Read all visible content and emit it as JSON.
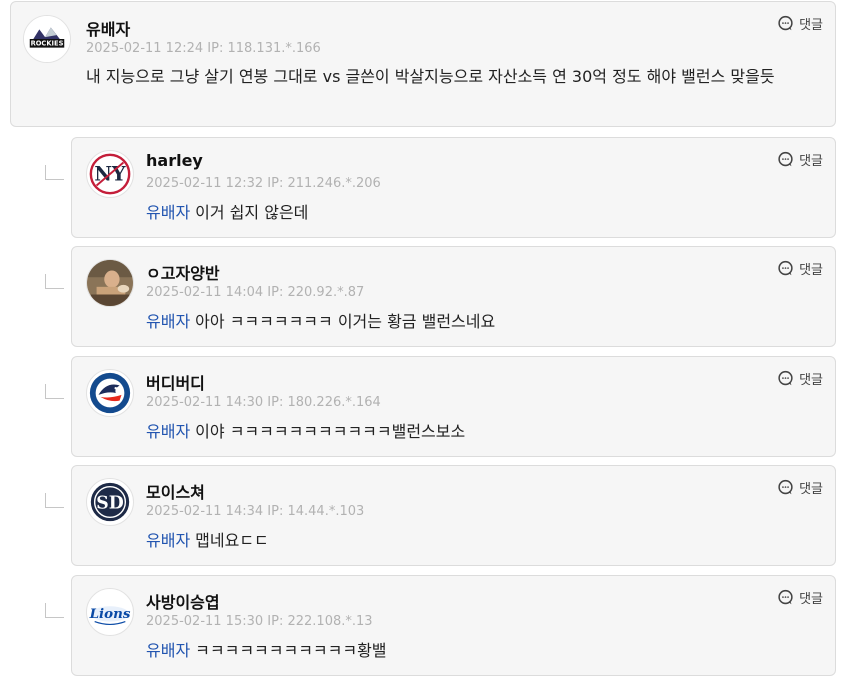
{
  "reply_label": "댓글",
  "mention_name": "유배자",
  "main_comment": {
    "author": "유배자",
    "timestamp": "2025-02-11 12:24",
    "ip": "IP: 118.131.*.166",
    "text": "내 지능으로 그냥 살기 연봉 그대로 vs 글쓴이 박살지능으로 자산소득 연 30억 정도 해야 밸런스 맞을듯",
    "avatar": "rockies-logo"
  },
  "replies": [
    {
      "author": "harley",
      "timestamp": "2025-02-11 12:32",
      "ip": "IP: 211.246.*.206",
      "text": "이거 쉽지 않은데",
      "avatar": "yankees-logo"
    },
    {
      "author": "ㅇ고자양반",
      "timestamp": "2025-02-11 14:04",
      "ip": "IP: 220.92.*.87",
      "text": "아아 ㅋㅋㅋㅋㅋㅋㅋ 이거는 황금 밸런스네요",
      "avatar": "photo"
    },
    {
      "author": "버디버디",
      "timestamp": "2025-02-11 14:30",
      "ip": "IP: 180.226.*.164",
      "text": "이야 ㅋㅋㅋㅋㅋㅋㅋㅋㅋㅋㅋ밸런스보소",
      "avatar": "bluejays-logo"
    },
    {
      "author": "모이스쳐",
      "timestamp": "2025-02-11 14:34",
      "ip": "IP: 14.44.*.103",
      "text": "맵네요ㄷㄷ",
      "avatar": "padres-logo"
    },
    {
      "author": "사방이승엽",
      "timestamp": "2025-02-11 15:30",
      "ip": "IP: 222.108.*.13",
      "text": "ㅋㅋㅋㅋㅋㅋㅋㅋㅋㅋㅋ황밸",
      "avatar": "lions-logo"
    }
  ]
}
